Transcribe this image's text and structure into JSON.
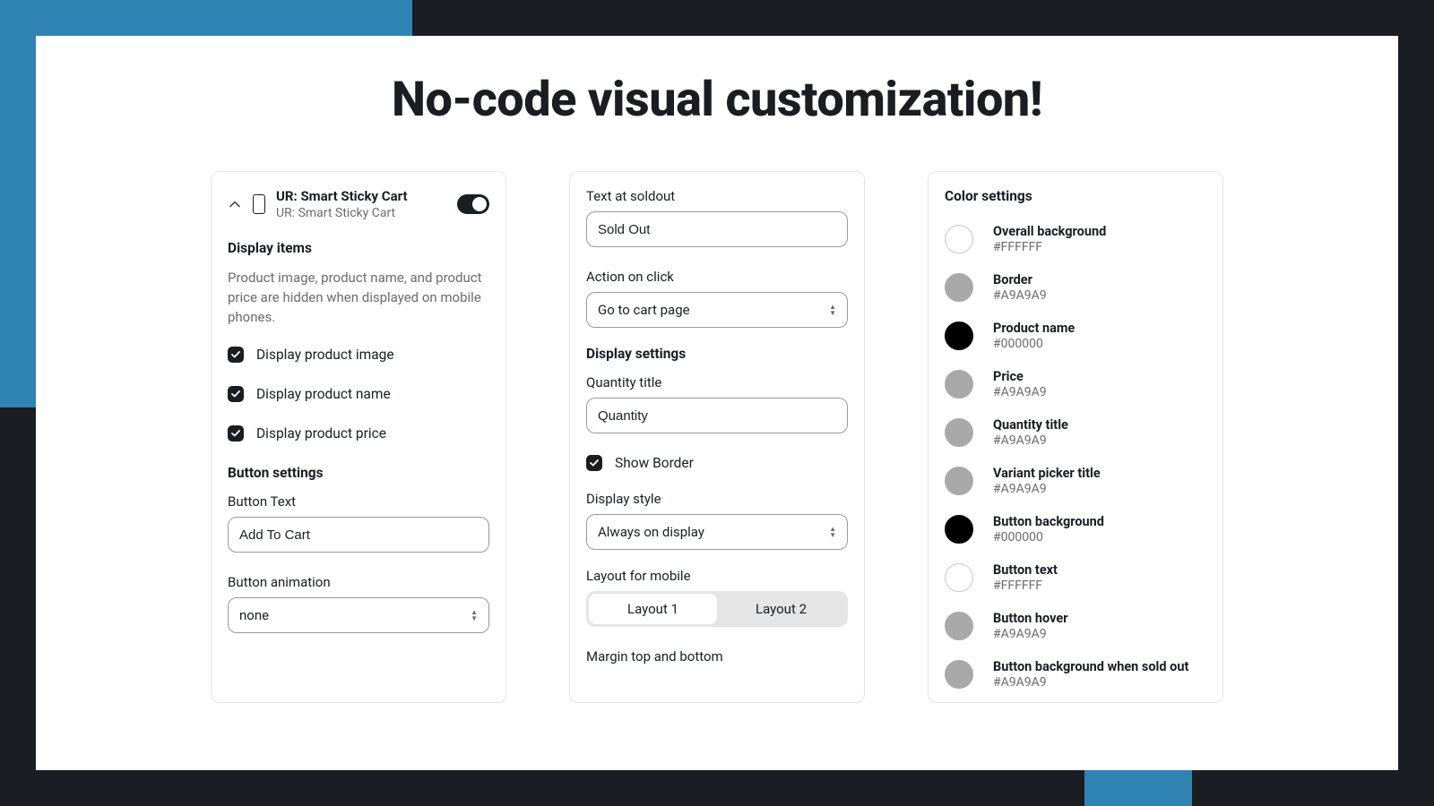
{
  "page": {
    "title": "No-code visual customization!"
  },
  "panel1": {
    "head_title": "UR: Smart Sticky Cart",
    "head_sub": "UR: Smart Sticky Cart",
    "display_items_title": "Display items",
    "display_items_desc": "Product image, product name, and product price are hidden when displayed on mobile phones.",
    "chk_image": "Display product image",
    "chk_name": "Display product name",
    "chk_price": "Display product price",
    "button_settings_title": "Button settings",
    "button_text_label": "Button Text",
    "button_text_value": "Add To Cart",
    "button_anim_label": "Button animation",
    "button_anim_value": "none"
  },
  "panel2": {
    "soldout_label": "Text at soldout",
    "soldout_value": "Sold Out",
    "action_label": "Action on click",
    "action_value": "Go to cart page",
    "display_settings_title": "Display settings",
    "qty_title_label": "Quantity title",
    "qty_title_value": "Quantity",
    "show_border_label": "Show Border",
    "display_style_label": "Display style",
    "display_style_value": "Always on display",
    "layout_label": "Layout for mobile",
    "layout1": "Layout 1",
    "layout2": "Layout 2",
    "margin_label": "Margin top and bottom"
  },
  "panel3": {
    "title": "Color settings",
    "colors": [
      {
        "name": "Overall background",
        "hex": "#FFFFFF",
        "swatch": "#FFFFFF"
      },
      {
        "name": "Border",
        "hex": "#A9A9A9",
        "swatch": "#A9A9A9"
      },
      {
        "name": "Product name",
        "hex": "#000000",
        "swatch": "#000000"
      },
      {
        "name": "Price",
        "hex": "#A9A9A9",
        "swatch": "#A9A9A9"
      },
      {
        "name": "Quantity title",
        "hex": "#A9A9A9",
        "swatch": "#A9A9A9"
      },
      {
        "name": "Variant picker title",
        "hex": "#A9A9A9",
        "swatch": "#A9A9A9"
      },
      {
        "name": "Button background",
        "hex": "#000000",
        "swatch": "#000000"
      },
      {
        "name": "Button text",
        "hex": "#FFFFFF",
        "swatch": "#FFFFFF"
      },
      {
        "name": "Button hover",
        "hex": "#A9A9A9",
        "swatch": "#A9A9A9"
      },
      {
        "name": "Button background when sold out",
        "hex": "#A9A9A9",
        "swatch": "#A9A9A9"
      }
    ]
  }
}
